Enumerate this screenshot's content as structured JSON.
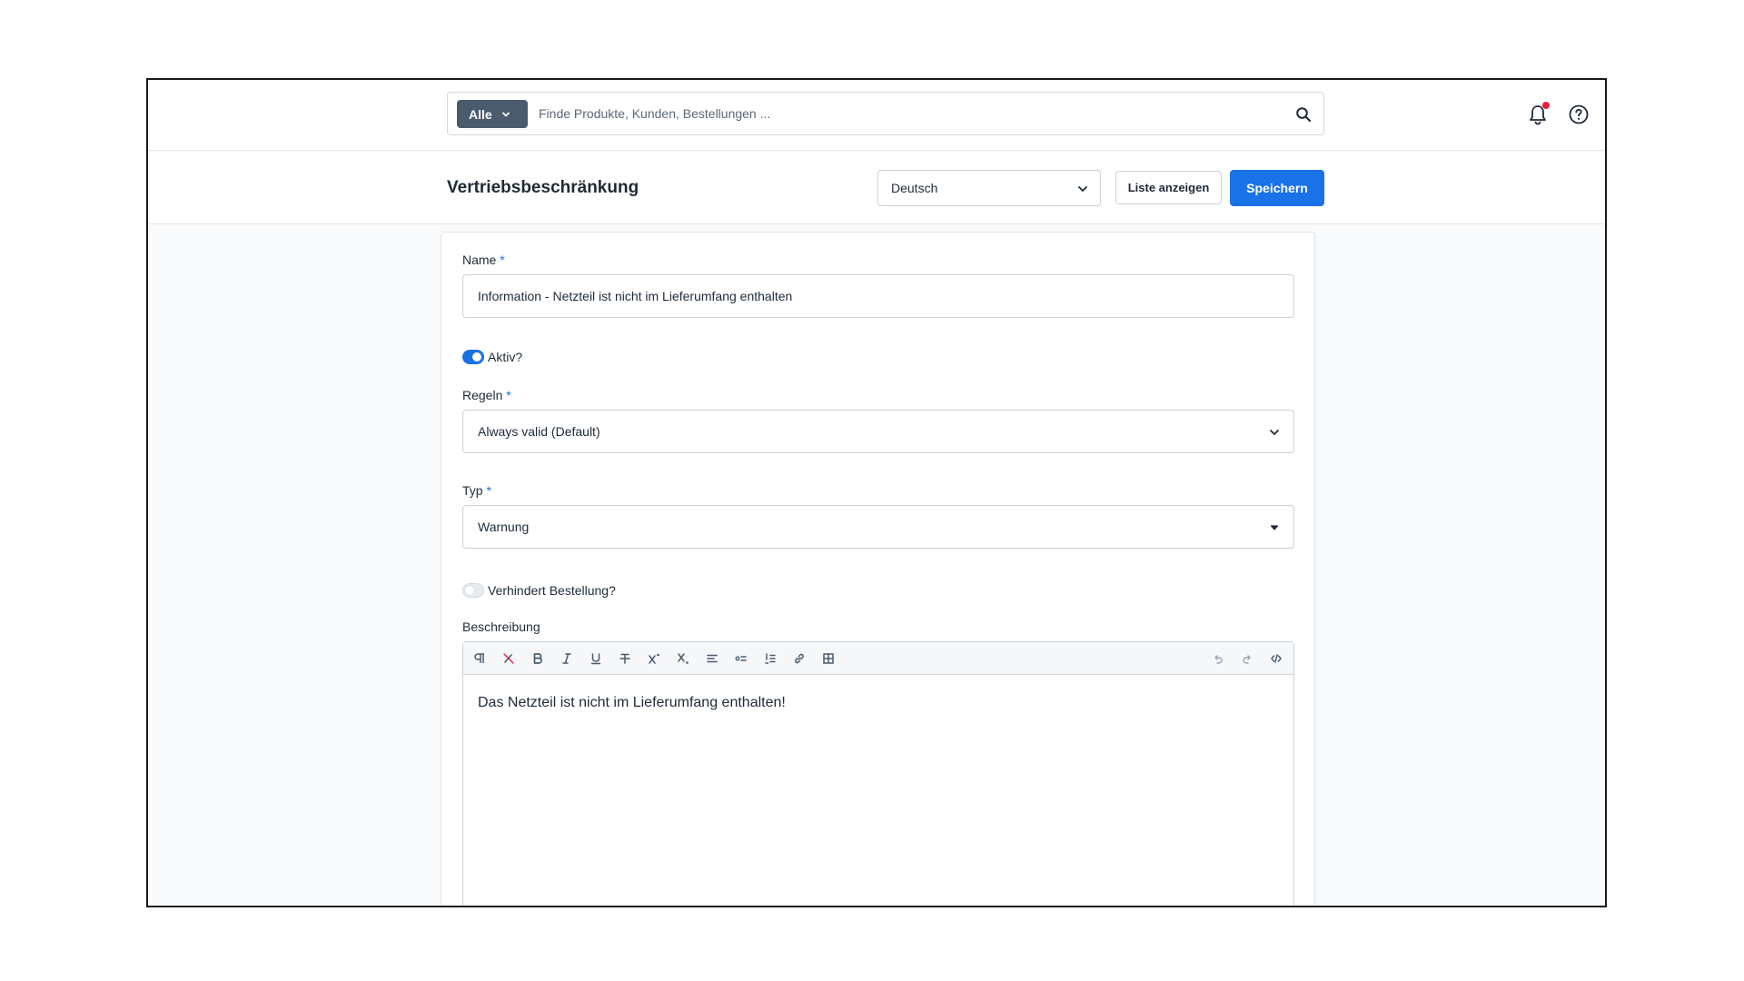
{
  "search": {
    "type_label": "Alle",
    "placeholder": "Finde Produkte, Kunden, Bestellungen ..."
  },
  "header": {
    "title": "Vertriebsbeschränkung",
    "language": "Deutsch",
    "list_button": "Liste anzeigen",
    "save_button": "Speichern"
  },
  "form": {
    "name_label": "Name",
    "required_mark": "*",
    "name_value": "Information - Netzteil ist nicht im Lieferumfang enthalten",
    "active_label": "Aktiv?",
    "active_on": true,
    "rules_label": "Regeln",
    "rules_value": "Always valid (Default)",
    "type_label": "Typ",
    "type_value": "Warnung",
    "prevent_label": "Verhindert Bestellung?",
    "prevent_on": false,
    "description_label": "Beschreibung",
    "description_content": "Das Netzteil ist nicht im Lieferumfang enthalten!"
  },
  "toolbar_icons": [
    "paragraph-icon",
    "clear-format-icon",
    "bold-icon",
    "italic-icon",
    "underline-icon",
    "strikethrough-icon",
    "superscript-icon",
    "subscript-icon",
    "align-icon",
    "unordered-list-icon",
    "ordered-list-icon",
    "link-icon",
    "table-icon",
    "undo-icon",
    "redo-icon",
    "code-view-icon"
  ],
  "colors": {
    "accent": "#1a72e8",
    "notification": "#e3203f",
    "search_type_bg": "#4b5b6e"
  }
}
